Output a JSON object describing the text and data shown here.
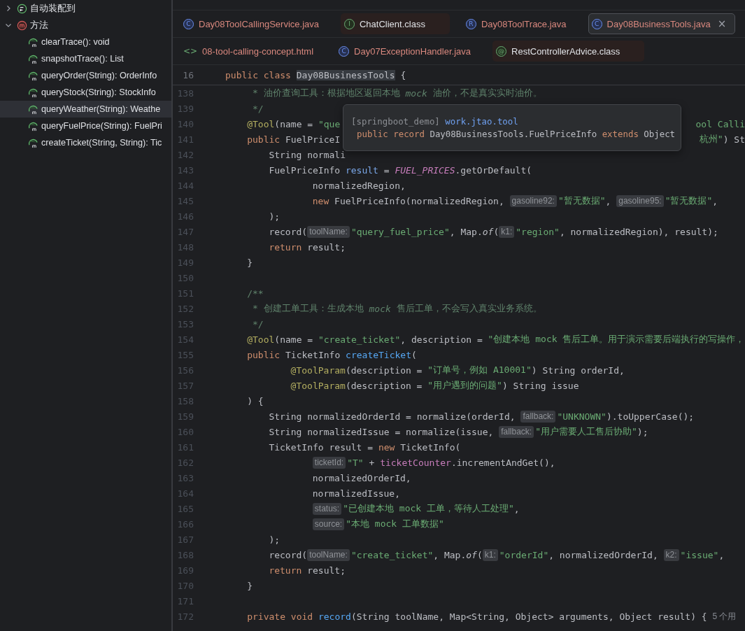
{
  "structure": {
    "items": [
      {
        "label": "自动装配到",
        "kind": "autowired",
        "expanded": false,
        "selected": false
      },
      {
        "label": "方法",
        "kind": "method-group",
        "expanded": true,
        "selected": false,
        "children": [
          {
            "label": "clearTrace(): void",
            "kind": "method",
            "selected": false
          },
          {
            "label": "snapshotTrace(): List",
            "kind": "method",
            "selected": false
          },
          {
            "label": "queryOrder(String): OrderInfo",
            "kind": "method",
            "selected": false
          },
          {
            "label": "queryStock(String): StockInfo",
            "kind": "method",
            "selected": false
          },
          {
            "label": "queryWeather(String): Weathe",
            "kind": "method",
            "selected": true
          },
          {
            "label": "queryFuelPrice(String): FuelPri",
            "kind": "method",
            "selected": false
          },
          {
            "label": "createTicket(String, String): Tic",
            "kind": "method",
            "selected": false
          }
        ]
      }
    ]
  },
  "editor_tabs": {
    "rows": [
      {
        "tabs": [
          {
            "label": "Day08ToolCallingService.java",
            "kind": "class",
            "icon": "C",
            "readonly": false,
            "selected": false
          },
          {
            "label": "ChatClient.class",
            "kind": "interface",
            "icon": "I",
            "readonly": true,
            "selected": false
          },
          {
            "label": "Day08ToolTrace.java",
            "kind": "record",
            "icon": "R",
            "readonly": false,
            "selected": false
          },
          {
            "label": "Day08BusinessTools.java",
            "kind": "class",
            "icon": "C",
            "readonly": false,
            "selected": true,
            "close": "×"
          }
        ]
      },
      {
        "tabs": [
          {
            "label": "08-tool-calling-concept.html",
            "kind": "html",
            "icon": "<>",
            "readonly": false,
            "selected": false
          },
          {
            "label": "Day07ExceptionHandler.java",
            "kind": "class",
            "icon": "C",
            "readonly": false,
            "selected": false
          },
          {
            "label": "RestControllerAdvice.class",
            "kind": "annotation",
            "icon": "@",
            "readonly": true,
            "selected": false
          }
        ]
      }
    ]
  },
  "editor": {
    "sticky_line": {
      "number": "16",
      "tokens": [
        {
          "kind": "keyword",
          "text": "public class "
        },
        {
          "kind": "highlight",
          "text": "Day08BusinessTools"
        },
        {
          "kind": "plain",
          "text": " {"
        }
      ]
    },
    "lines": [
      {
        "number": "138",
        "kind": "doc",
        "tokens": [
          {
            "kind": "doc",
            "text": "* 油价查询工具：根据地区返回本地 "
          },
          {
            "kind": "doc-em",
            "text": "mock"
          },
          {
            "kind": "doc",
            "text": " 油价，不是真实实时油价。"
          }
        ]
      },
      {
        "number": "139",
        "kind": "doc",
        "tokens": [
          {
            "kind": "doc",
            "text": "*/"
          }
        ]
      },
      {
        "number": "140",
        "kind": "member",
        "tokens": [
          {
            "kind": "annotation",
            "text": "@Tool"
          },
          {
            "kind": "plain",
            "text": "(name = "
          },
          {
            "kind": "string",
            "text": "\"que"
          }
        ],
        "tail": [
          {
            "kind": "string",
            "text": "ool Calli"
          }
        ]
      },
      {
        "number": "141",
        "kind": "member",
        "tokens": [
          {
            "kind": "keyword",
            "text": "public "
          },
          {
            "kind": "plain",
            "text": "FuelPriceI"
          }
        ],
        "tail": [
          {
            "kind": "string",
            "text": "杭州\""
          },
          {
            "kind": "plain",
            "text": ") St"
          }
        ]
      },
      {
        "number": "142",
        "kind": "body",
        "tokens": [
          {
            "kind": "plain",
            "text": "String normali"
          }
        ]
      },
      {
        "number": "143",
        "kind": "body",
        "tokens": [
          {
            "kind": "plain",
            "text": "FuelPriceInfo "
          },
          {
            "kind": "local",
            "text": "result"
          },
          {
            "kind": "plain",
            "text": " = "
          },
          {
            "kind": "static-field",
            "text": "FUEL_PRICES"
          },
          {
            "kind": "plain",
            "text": ".getOrDefault("
          }
        ]
      },
      {
        "number": "144",
        "kind": "argument",
        "tokens": [
          {
            "kind": "plain",
            "text": "normalizedRegion,"
          }
        ]
      },
      {
        "number": "145",
        "kind": "argument",
        "tokens": [
          {
            "kind": "keyword",
            "text": "new "
          },
          {
            "kind": "plain",
            "text": "FuelPriceInfo(normalizedRegion, "
          },
          {
            "kind": "hint",
            "text": "gasoline92:"
          },
          {
            "kind": "string",
            "text": "\"暂无数据\""
          },
          {
            "kind": "plain",
            "text": ", "
          },
          {
            "kind": "hint",
            "text": "gasoline95:"
          },
          {
            "kind": "string",
            "text": "\"暂无数据\""
          },
          {
            "kind": "plain",
            "text": ","
          }
        ]
      },
      {
        "number": "146",
        "kind": "body",
        "tokens": [
          {
            "kind": "plain",
            "text": ");"
          }
        ]
      },
      {
        "number": "147",
        "kind": "body",
        "tokens": [
          {
            "kind": "plain",
            "text": "record("
          },
          {
            "kind": "hint",
            "text": "toolName:"
          },
          {
            "kind": "string",
            "text": "\"query_fuel_price\""
          },
          {
            "kind": "plain",
            "text": ", Map."
          },
          {
            "kind": "static-call",
            "text": "of"
          },
          {
            "kind": "plain",
            "text": "("
          },
          {
            "kind": "hint",
            "text": "k1:"
          },
          {
            "kind": "string",
            "text": "\"region\""
          },
          {
            "kind": "plain",
            "text": ", normalizedRegion), result);"
          }
        ]
      },
      {
        "number": "148",
        "kind": "body",
        "tokens": [
          {
            "kind": "keyword",
            "text": "return "
          },
          {
            "kind": "plain",
            "text": "result;"
          }
        ]
      },
      {
        "number": "149",
        "kind": "member",
        "tokens": [
          {
            "kind": "plain",
            "text": "}"
          }
        ]
      },
      {
        "number": "150"
      },
      {
        "number": "151",
        "kind": "member",
        "tokens": [
          {
            "kind": "doc",
            "text": "/**"
          }
        ]
      },
      {
        "number": "152",
        "kind": "doc",
        "tokens": [
          {
            "kind": "doc",
            "text": "* 创建工单工具：生成本地 "
          },
          {
            "kind": "doc-em",
            "text": "mock"
          },
          {
            "kind": "doc",
            "text": " 售后工单，不会写入真实业务系统。"
          }
        ]
      },
      {
        "number": "153",
        "kind": "doc",
        "tokens": [
          {
            "kind": "doc",
            "text": "*/"
          }
        ]
      },
      {
        "number": "154",
        "kind": "member",
        "tokens": [
          {
            "kind": "annotation",
            "text": "@Tool"
          },
          {
            "kind": "plain",
            "text": "(name = "
          },
          {
            "kind": "string",
            "text": "\"create_ticket\""
          },
          {
            "kind": "plain",
            "text": ", description = "
          },
          {
            "kind": "string",
            "text": "\"创建本地 mock 售后工单。用于演示需要后端执行的写操作，"
          }
        ]
      },
      {
        "number": "155",
        "kind": "member",
        "tokens": [
          {
            "kind": "keyword",
            "text": "public "
          },
          {
            "kind": "plain",
            "text": "TicketInfo "
          },
          {
            "kind": "method",
            "text": "createTicket"
          },
          {
            "kind": "plain",
            "text": "("
          }
        ]
      },
      {
        "number": "156",
        "kind": "parameter",
        "tokens": [
          {
            "kind": "annotation",
            "text": "@ToolParam"
          },
          {
            "kind": "plain",
            "text": "(description = "
          },
          {
            "kind": "string",
            "text": "\"订单号，例如 A10001\""
          },
          {
            "kind": "plain",
            "text": ") String orderId,"
          }
        ]
      },
      {
        "number": "157",
        "kind": "parameter",
        "tokens": [
          {
            "kind": "annotation",
            "text": "@ToolParam"
          },
          {
            "kind": "plain",
            "text": "(description = "
          },
          {
            "kind": "string",
            "text": "\"用户遇到的问题\""
          },
          {
            "kind": "plain",
            "text": ") String issue"
          }
        ]
      },
      {
        "number": "158",
        "kind": "member",
        "tokens": [
          {
            "kind": "plain",
            "text": ") {"
          }
        ]
      },
      {
        "number": "159",
        "kind": "body",
        "tokens": [
          {
            "kind": "plain",
            "text": "String normalizedOrderId = normalize(orderId, "
          },
          {
            "kind": "hint",
            "text": "fallback:"
          },
          {
            "kind": "string",
            "text": "\"UNKNOWN\""
          },
          {
            "kind": "plain",
            "text": ").toUpperCase();"
          }
        ]
      },
      {
        "number": "160",
        "kind": "body",
        "tokens": [
          {
            "kind": "plain",
            "text": "String normalizedIssue = normalize(issue, "
          },
          {
            "kind": "hint",
            "text": "fallback:"
          },
          {
            "kind": "string",
            "text": "\"用户需要人工售后协助\""
          },
          {
            "kind": "plain",
            "text": ");"
          }
        ]
      },
      {
        "number": "161",
        "kind": "body",
        "tokens": [
          {
            "kind": "plain",
            "text": "TicketInfo result = "
          },
          {
            "kind": "keyword",
            "text": "new "
          },
          {
            "kind": "plain",
            "text": "TicketInfo("
          }
        ]
      },
      {
        "number": "162",
        "kind": "argument",
        "tokens": [
          {
            "kind": "hint",
            "text": "ticketId:"
          },
          {
            "kind": "string",
            "text": "\"T\""
          },
          {
            "kind": "plain",
            "text": " + "
          },
          {
            "kind": "field",
            "text": "ticketCounter"
          },
          {
            "kind": "plain",
            "text": ".incrementAndGet(),"
          }
        ]
      },
      {
        "number": "163",
        "kind": "argument",
        "tokens": [
          {
            "kind": "plain",
            "text": "normalizedOrderId,"
          }
        ]
      },
      {
        "number": "164",
        "kind": "argument",
        "tokens": [
          {
            "kind": "plain",
            "text": "normalizedIssue,"
          }
        ]
      },
      {
        "number": "165",
        "kind": "argument",
        "tokens": [
          {
            "kind": "hint",
            "text": "status:"
          },
          {
            "kind": "string",
            "text": "\"已创建本地 mock 工单，等待人工处理\""
          },
          {
            "kind": "plain",
            "text": ","
          }
        ]
      },
      {
        "number": "166",
        "kind": "argument",
        "tokens": [
          {
            "kind": "hint",
            "text": "source:"
          },
          {
            "kind": "string",
            "text": "\"本地 mock 工单数据\""
          }
        ]
      },
      {
        "number": "167",
        "kind": "body",
        "tokens": [
          {
            "kind": "plain",
            "text": ");"
          }
        ]
      },
      {
        "number": "168",
        "kind": "body",
        "tokens": [
          {
            "kind": "plain",
            "text": "record("
          },
          {
            "kind": "hint",
            "text": "toolName:"
          },
          {
            "kind": "string",
            "text": "\"create_ticket\""
          },
          {
            "kind": "plain",
            "text": ", Map."
          },
          {
            "kind": "static-call",
            "text": "of"
          },
          {
            "kind": "plain",
            "text": "("
          },
          {
            "kind": "hint",
            "text": "k1:"
          },
          {
            "kind": "string",
            "text": "\"orderId\""
          },
          {
            "kind": "plain",
            "text": ", normalizedOrderId, "
          },
          {
            "kind": "hint",
            "text": "k2:"
          },
          {
            "kind": "string",
            "text": "\"issue\""
          },
          {
            "kind": "plain",
            "text": ","
          }
        ]
      },
      {
        "number": "169",
        "kind": "body",
        "tokens": [
          {
            "kind": "keyword",
            "text": "return "
          },
          {
            "kind": "plain",
            "text": "result;"
          }
        ]
      },
      {
        "number": "170",
        "kind": "member",
        "tokens": [
          {
            "kind": "plain",
            "text": "}"
          }
        ]
      },
      {
        "number": "171"
      },
      {
        "number": "172",
        "kind": "member",
        "tokens": [
          {
            "kind": "keyword",
            "text": "private void "
          },
          {
            "kind": "method",
            "text": "record"
          },
          {
            "kind": "plain",
            "text": "(String toolName, Map<String, Object> arguments, Object result) { "
          },
          {
            "kind": "usage",
            "text": "5 个用"
          }
        ]
      }
    ]
  },
  "tooltip": {
    "lines": [
      [
        {
          "kind": "muted",
          "text": "[springboot_demo] "
        },
        {
          "kind": "package",
          "text": "work.jtao.tool"
        }
      ],
      [
        {
          "kind": "keyword",
          "text": "public record "
        },
        {
          "kind": "plain",
          "text": "Day08BusinessTools.FuelPriceInfo "
        },
        {
          "kind": "keyword",
          "text": "extends "
        },
        {
          "kind": "plain",
          "text": "Object"
        }
      ]
    ]
  }
}
